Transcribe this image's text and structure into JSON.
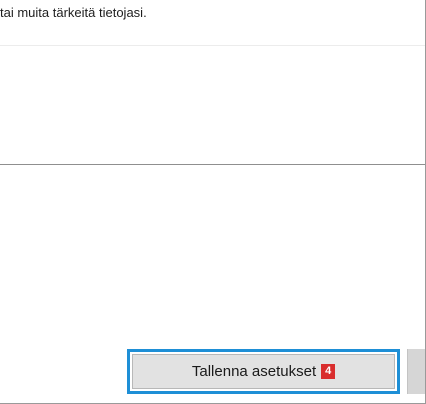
{
  "info": {
    "text": "tai muita tärkeitä tietojasi."
  },
  "footer": {
    "save_label": "Tallenna asetukset",
    "step_badge": "4",
    "accent_color": "#1e8fd6",
    "badge_color": "#d92d2d"
  }
}
